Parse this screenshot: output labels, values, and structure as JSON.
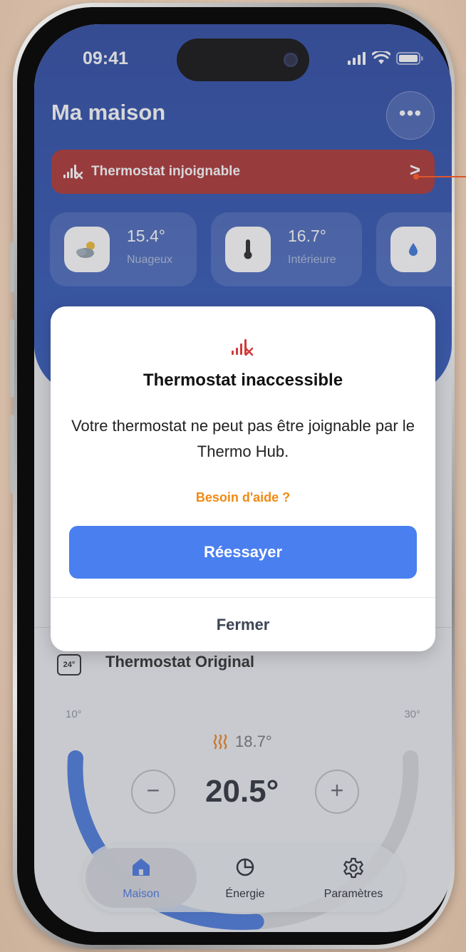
{
  "status_bar": {
    "time": "09:41"
  },
  "header": {
    "title": "Ma maison",
    "more_label": "•••"
  },
  "alert": {
    "label": "Thermostat injoignable",
    "chevron": ">"
  },
  "weather_cards": [
    {
      "value": "15.4°",
      "label": "Nuageux",
      "icon": "cloud-sun-icon"
    },
    {
      "value": "16.7°",
      "label": "Intérieure",
      "icon": "thermometer-icon"
    },
    {
      "value": "",
      "label": "",
      "icon": "water-drop-icon"
    }
  ],
  "modal": {
    "title": "Thermostat inaccessible",
    "message": "Votre thermostat ne peut pas être joignable par le Thermo Hub.",
    "help_link": "Besoin d'aide ?",
    "retry_label": "Réessayer",
    "close_label": "Fermer"
  },
  "thermostat": {
    "icon_label": "24°",
    "name": "Thermostat Original",
    "range_min": "10°",
    "range_max": "30°",
    "current_temp": "18.7°",
    "setpoint": "20.5°",
    "minus_label": "−",
    "plus_label": "+",
    "setpoint_fraction": 0.525
  },
  "tabs": [
    {
      "label": "Maison",
      "icon": "home-icon",
      "active": true
    },
    {
      "label": "Énergie",
      "icon": "pie-chart-icon",
      "active": false
    },
    {
      "label": "Paramètres",
      "icon": "gear-icon",
      "active": false
    }
  ],
  "colors": {
    "header_blue": "#2550b8",
    "alert_red": "#a82828",
    "accent_blue": "#4a7ff0",
    "help_orange": "#f08a14",
    "heating_orange": "#e9821f"
  }
}
